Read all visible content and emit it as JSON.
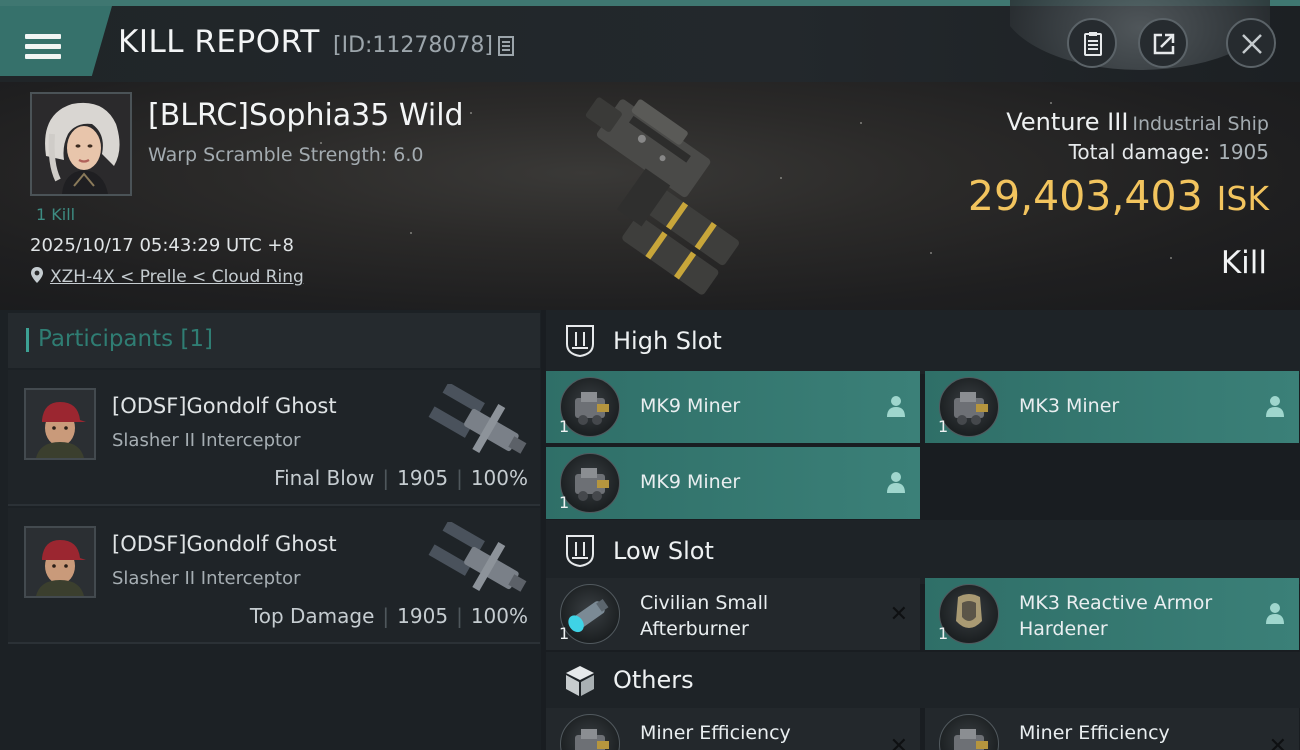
{
  "header": {
    "title": "KILL REPORT",
    "report_id": "[ID:11278078]"
  },
  "victim": {
    "name": "[BLRC]Sophia35 Wild",
    "warp_scramble": "Warp Scramble Strength: 6.0",
    "kills": "1 Kill",
    "datetime": "2025/10/17 05:43:29 UTC +8",
    "location": "XZH-4X < Prelle < Cloud Ring"
  },
  "ship": {
    "name": "Venture III",
    "class": "Industrial Ship",
    "total_damage_label": "Total damage:",
    "total_damage": "1905",
    "isk_value": "29,403,403",
    "isk_unit": "ISK",
    "outcome": "Kill"
  },
  "participants": {
    "label": "Participants",
    "count": "[1]",
    "rows": [
      {
        "name": "[ODSF]Gondolf Ghost",
        "ship": "Slasher II Interceptor",
        "role": "Final Blow",
        "damage": "1905",
        "percent": "100%"
      },
      {
        "name": "[ODSF]Gondolf Ghost",
        "ship": "Slasher II Interceptor",
        "role": "Top Damage",
        "damage": "1905",
        "percent": "100%"
      }
    ]
  },
  "sections": {
    "high": "High Slot",
    "low": "Low Slot",
    "others": "Others"
  },
  "modules": {
    "high": [
      {
        "name": "MK9 Miner",
        "qty": "1"
      },
      {
        "name": "MK3 Miner",
        "qty": "1"
      },
      {
        "name": "MK9 Miner",
        "qty": "1"
      }
    ],
    "low": [
      {
        "name": "Civilian Small Afterburner",
        "qty": "1"
      },
      {
        "name": "MK3 Reactive Armor Hardener",
        "qty": "1"
      }
    ],
    "others": [
      {
        "name": "Miner Efficiency"
      },
      {
        "name": "Miner Efficiency"
      }
    ]
  },
  "colors": {
    "accent": "#36716b",
    "isk": "#f2c45e",
    "slot_active": "#3b8078"
  }
}
